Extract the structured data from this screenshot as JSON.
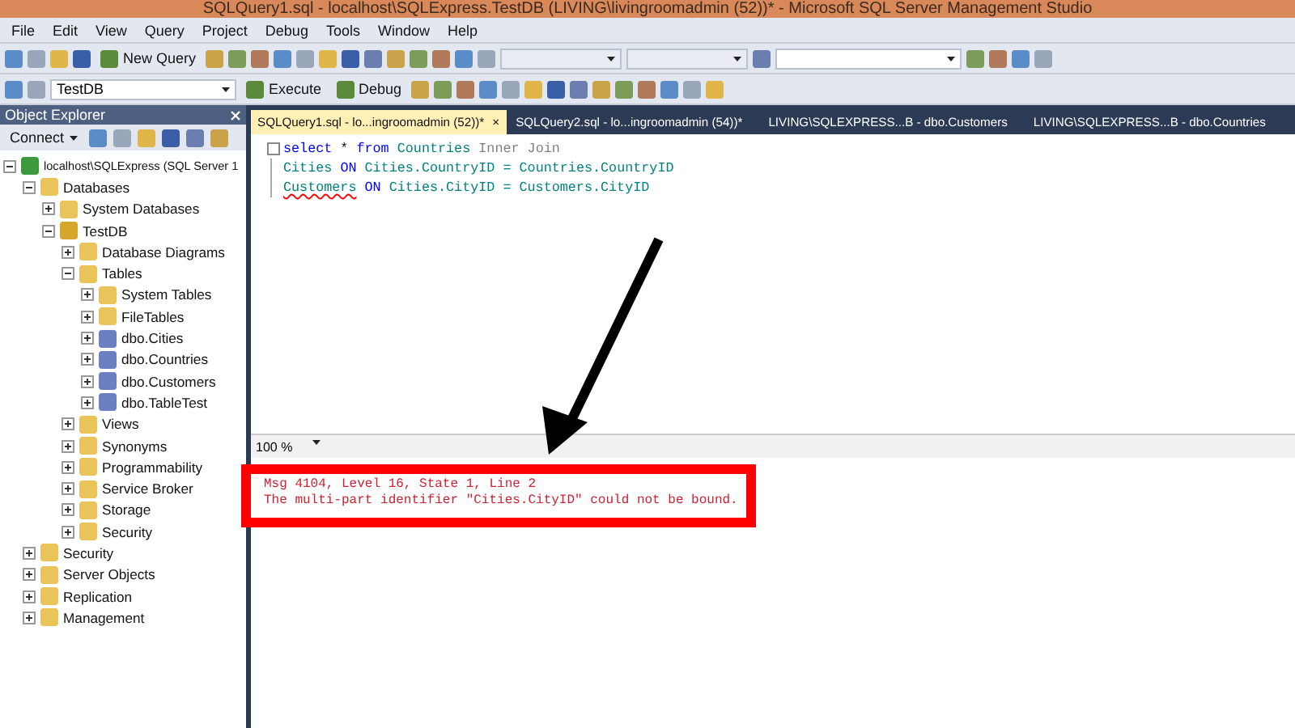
{
  "window": {
    "title": "SQLQuery1.sql - localhost\\SQLExpress.TestDB (LIVING\\livingroomadmin (52))* - Microsoft SQL Server Management Studio"
  },
  "menu": [
    "File",
    "Edit",
    "View",
    "Query",
    "Project",
    "Debug",
    "Tools",
    "Window",
    "Help"
  ],
  "toolbar_1": [
    {
      "kind": "icon"
    },
    {
      "kind": "icon"
    },
    {
      "kind": "icon"
    },
    {
      "kind": "icon"
    },
    {
      "kind": "button",
      "label": "New Query"
    },
    {
      "kind": "icon"
    },
    {
      "kind": "icon"
    },
    {
      "kind": "icon"
    },
    {
      "kind": "icon"
    },
    {
      "kind": "icon"
    },
    {
      "kind": "icon"
    },
    {
      "kind": "icon"
    },
    {
      "kind": "icon"
    },
    {
      "kind": "icon"
    },
    {
      "kind": "icon"
    },
    {
      "kind": "icon"
    },
    {
      "kind": "icon"
    },
    {
      "kind": "icon"
    },
    {
      "kind": "dropdown"
    },
    {
      "kind": "dropdown"
    },
    {
      "kind": "icon"
    },
    {
      "kind": "field"
    },
    {
      "kind": "icon"
    },
    {
      "kind": "icon"
    },
    {
      "kind": "icon"
    },
    {
      "kind": "icon"
    }
  ],
  "toolbar_2": [
    {
      "kind": "icon"
    },
    {
      "kind": "icon"
    },
    {
      "kind": "database",
      "label": "TestDB"
    },
    {
      "kind": "button",
      "label": "Execute"
    },
    {
      "kind": "button",
      "label": "Debug"
    },
    {
      "kind": "icon"
    },
    {
      "kind": "icon"
    },
    {
      "kind": "icon"
    },
    {
      "kind": "icon"
    },
    {
      "kind": "icon"
    },
    {
      "kind": "icon"
    },
    {
      "kind": "icon"
    },
    {
      "kind": "icon"
    },
    {
      "kind": "icon"
    },
    {
      "kind": "icon"
    },
    {
      "kind": "icon"
    },
    {
      "kind": "icon"
    },
    {
      "kind": "icon"
    },
    {
      "kind": "icon"
    }
  ],
  "object_explorer": {
    "title": "Object Explorer",
    "connect": "Connect",
    "tree": [
      {
        "label": "localhost\\SQLExpress (SQL Server 1",
        "kind": "server",
        "expanded": true,
        "children": [
          {
            "label": "Databases",
            "kind": "folder",
            "expanded": true,
            "children": [
              {
                "label": "System Databases",
                "kind": "folder",
                "expanded": false
              },
              {
                "label": "TestDB",
                "kind": "database",
                "expanded": true,
                "children": [
                  {
                    "label": "Database Diagrams",
                    "kind": "folder",
                    "expanded": false
                  },
                  {
                    "label": "Tables",
                    "kind": "folder",
                    "expanded": true,
                    "children": [
                      {
                        "label": "System Tables",
                        "kind": "folder",
                        "expanded": false
                      },
                      {
                        "label": "FileTables",
                        "kind": "folder",
                        "expanded": false
                      },
                      {
                        "label": "dbo.Cities",
                        "kind": "table",
                        "expanded": false
                      },
                      {
                        "label": "dbo.Countries",
                        "kind": "table",
                        "expanded": false
                      },
                      {
                        "label": "dbo.Customers",
                        "kind": "table",
                        "expanded": false
                      },
                      {
                        "label": "dbo.TableTest",
                        "kind": "table",
                        "expanded": false
                      }
                    ]
                  },
                  {
                    "label": "Views",
                    "kind": "folder",
                    "expanded": false
                  },
                  {
                    "label": "Synonyms",
                    "kind": "folder",
                    "expanded": false
                  },
                  {
                    "label": "Programmability",
                    "kind": "folder",
                    "expanded": false
                  },
                  {
                    "label": "Service Broker",
                    "kind": "folder",
                    "expanded": false
                  },
                  {
                    "label": "Storage",
                    "kind": "folder",
                    "expanded": false
                  },
                  {
                    "label": "Security",
                    "kind": "folder",
                    "expanded": false
                  }
                ]
              }
            ]
          },
          {
            "label": "Security",
            "kind": "folder",
            "expanded": false
          },
          {
            "label": "Server Objects",
            "kind": "folder",
            "expanded": false
          },
          {
            "label": "Replication",
            "kind": "folder",
            "expanded": false
          },
          {
            "label": "Management",
            "kind": "folder",
            "expanded": false
          }
        ]
      }
    ]
  },
  "tabs": [
    {
      "label": "SQLQuery1.sql - lo...ingroomadmin (52))*",
      "selected": true,
      "close": "×"
    },
    {
      "label": "SQLQuery2.sql - lo...ingroomadmin (54))*",
      "selected": false
    },
    {
      "label": "LIVING\\SQLEXPRESS...B - dbo.Customers",
      "selected": false
    },
    {
      "label": "LIVING\\SQLEXPRESS...B - dbo.Countries",
      "selected": false
    }
  ],
  "editor": {
    "lines": [
      {
        "collapse": true,
        "tokens": [
          {
            "text": "select",
            "kind": "keyword"
          },
          {
            "text": " * ",
            "kind": "plain"
          },
          {
            "text": "from",
            "kind": "keyword"
          },
          {
            "text": " Countries ",
            "kind": "identifier"
          },
          {
            "text": "Inner Join",
            "kind": "muted"
          }
        ]
      },
      {
        "collapse": false,
        "tokens": [
          {
            "text": "Cities ",
            "kind": "identifier"
          },
          {
            "text": "ON",
            "kind": "keyword"
          },
          {
            "text": " Cities.CountryID = Countries.CountryID",
            "kind": "identifier"
          }
        ]
      },
      {
        "collapse": false,
        "tokens": [
          {
            "text": "Customers",
            "kind": "error"
          },
          {
            "text": " ON",
            "kind": "keyword"
          },
          {
            "text": " Cities.CityID = Customers.CityID",
            "kind": "identifier"
          }
        ]
      }
    ]
  },
  "zoom": "100 %",
  "messages": [
    "Msg 4104, Level 16, State 1, Line 2",
    "The multi-part identifier \"Cities.CityID\" could not be bound."
  ]
}
